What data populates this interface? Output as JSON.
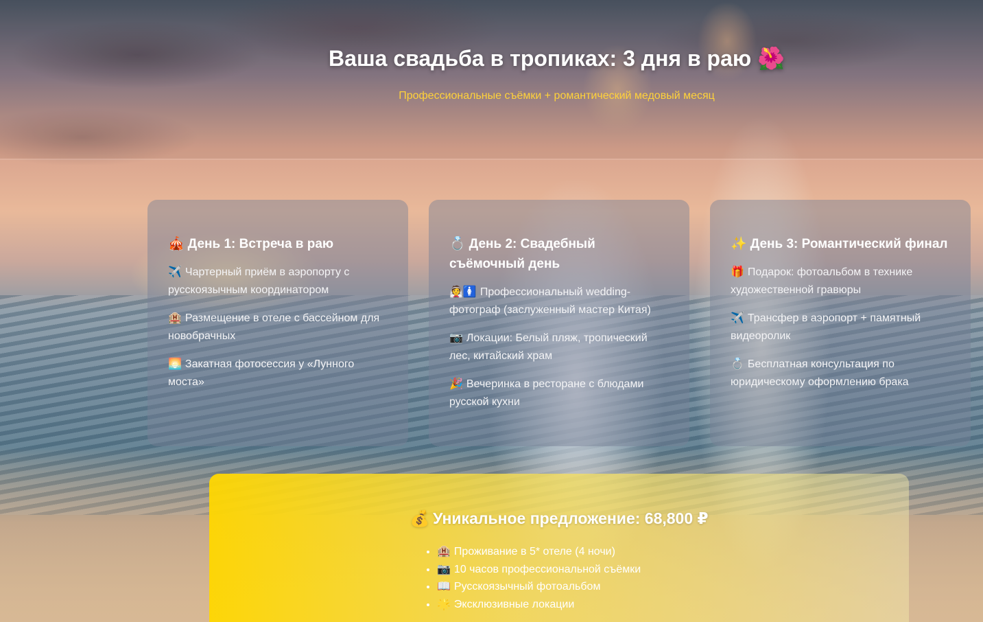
{
  "hero": {
    "title": "Ваша свадьба в тропиках: 3 дня в раю",
    "title_icon": "🌺",
    "subtitle": "Профессиональные съёмки + романтический медовый месяц"
  },
  "days": [
    {
      "icon": "🎪",
      "title": "День 1: Встреча в раю",
      "items": [
        {
          "icon": "✈️",
          "text": "Чартерный приём в аэропорту с русскоязычным координатором"
        },
        {
          "icon": "🏨",
          "text": "Размещение в отеле с бассейном для новобрачных"
        },
        {
          "icon": "🌅",
          "text": "Закатная фотосессия у «Лунного моста»"
        }
      ]
    },
    {
      "icon": "💍",
      "title": "День 2: Свадебный съёмочный день",
      "items": [
        {
          "icon": "👰🚺",
          "text": "Профессиональный wedding-фотограф (заслуженный мастер Китая)"
        },
        {
          "icon": "📷",
          "text": "Локации: Белый пляж, тропический лес, китайский храм"
        },
        {
          "icon": "🎉",
          "text": "Вечеринка в ресторане с блюдами русской кухни"
        }
      ]
    },
    {
      "icon": "✨",
      "title": "День 3: Романтический финал",
      "items": [
        {
          "icon": "🎁",
          "text": "Подарок: фотоальбом в технике художественной гравюры"
        },
        {
          "icon": "✈️",
          "text": "Трансфер в аэропорт + памятный видеоролик"
        },
        {
          "icon": "💍",
          "text": "Бесплатная консультация по юридическому оформлению брака"
        }
      ]
    }
  ],
  "offer": {
    "icon": "💰",
    "title": "Уникальное предложение: 68,800 ₽",
    "items": [
      {
        "icon": "🏨",
        "text": "Проживание в 5* отеле (4 ночи)"
      },
      {
        "icon": "📷",
        "text": "10 часов профессиональной съёмки"
      },
      {
        "icon": "📖",
        "text": "Русскоязычный фотоальбом"
      },
      {
        "icon": "🌟",
        "text": "Эксклюзивные локации"
      }
    ]
  }
}
